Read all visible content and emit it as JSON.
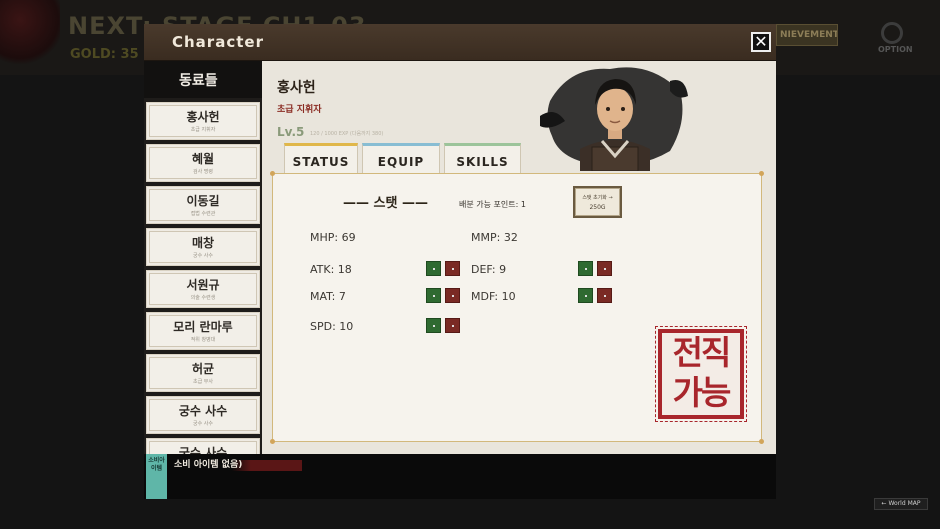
{
  "background": {
    "stage_text": "NEXT: STAGE CH1-03",
    "gold_text": "GOLD: 35",
    "achievement_label": "NIEVEMENT",
    "option_label": "OPTION"
  },
  "window": {
    "title": "Character",
    "close_label": "✕"
  },
  "sidebar": {
    "header": "동료들",
    "items": [
      {
        "name": "홍사헌",
        "class": "초급 지휘자"
      },
      {
        "name": "혜월",
        "class": "검사 명령"
      },
      {
        "name": "이동길",
        "class": "접법 수련관"
      },
      {
        "name": "매창",
        "class": "궁수 사수"
      },
      {
        "name": "서원규",
        "class": "의술 수련생"
      },
      {
        "name": "모리 란마루",
        "class": "적위 창병대"
      },
      {
        "name": "허균",
        "class": "초급 무사"
      },
      {
        "name": "궁수 사수",
        "class": "궁수 사수"
      },
      {
        "name": "궁수 사수",
        "class": ""
      }
    ]
  },
  "character": {
    "name": "홍사헌",
    "class": "초급 지휘자",
    "level": "Lv.5",
    "exp": "120 / 1000 EXP (다음까지 380)"
  },
  "tabs": [
    {
      "label": "STATUS",
      "active": true
    },
    {
      "label": "EQUIP",
      "active": false
    },
    {
      "label": "SKILLS",
      "active": false
    }
  ],
  "stats_panel": {
    "heading": "—— 스탯 ——",
    "points_label": "배분 가능 포인트: 1",
    "reset_button": {
      "label": "스탯 초기화 →",
      "cost": "250G"
    },
    "mhp": "MHP: 69",
    "mmp": "MMP: 32",
    "atk": "ATK: 18",
    "def": "DEF: 9",
    "mat": "MAT: 7",
    "mdf": "MDF: 10",
    "spd": "SPD: 10"
  },
  "stamp": {
    "line1": "전직",
    "line2": "가능"
  },
  "bottom": {
    "tag": "소비아이템",
    "text": "소비 아이템 없음)"
  },
  "world_map_label": "← World MAP",
  "colors": {
    "plus_button": "#2f6a31",
    "minus_button": "#7a2a24",
    "stamp_red": "#a8262c",
    "tab_status_accent": "#e0b74a",
    "tab_equip_accent": "#88bdd3",
    "tab_skills_accent": "#9cc49a"
  }
}
